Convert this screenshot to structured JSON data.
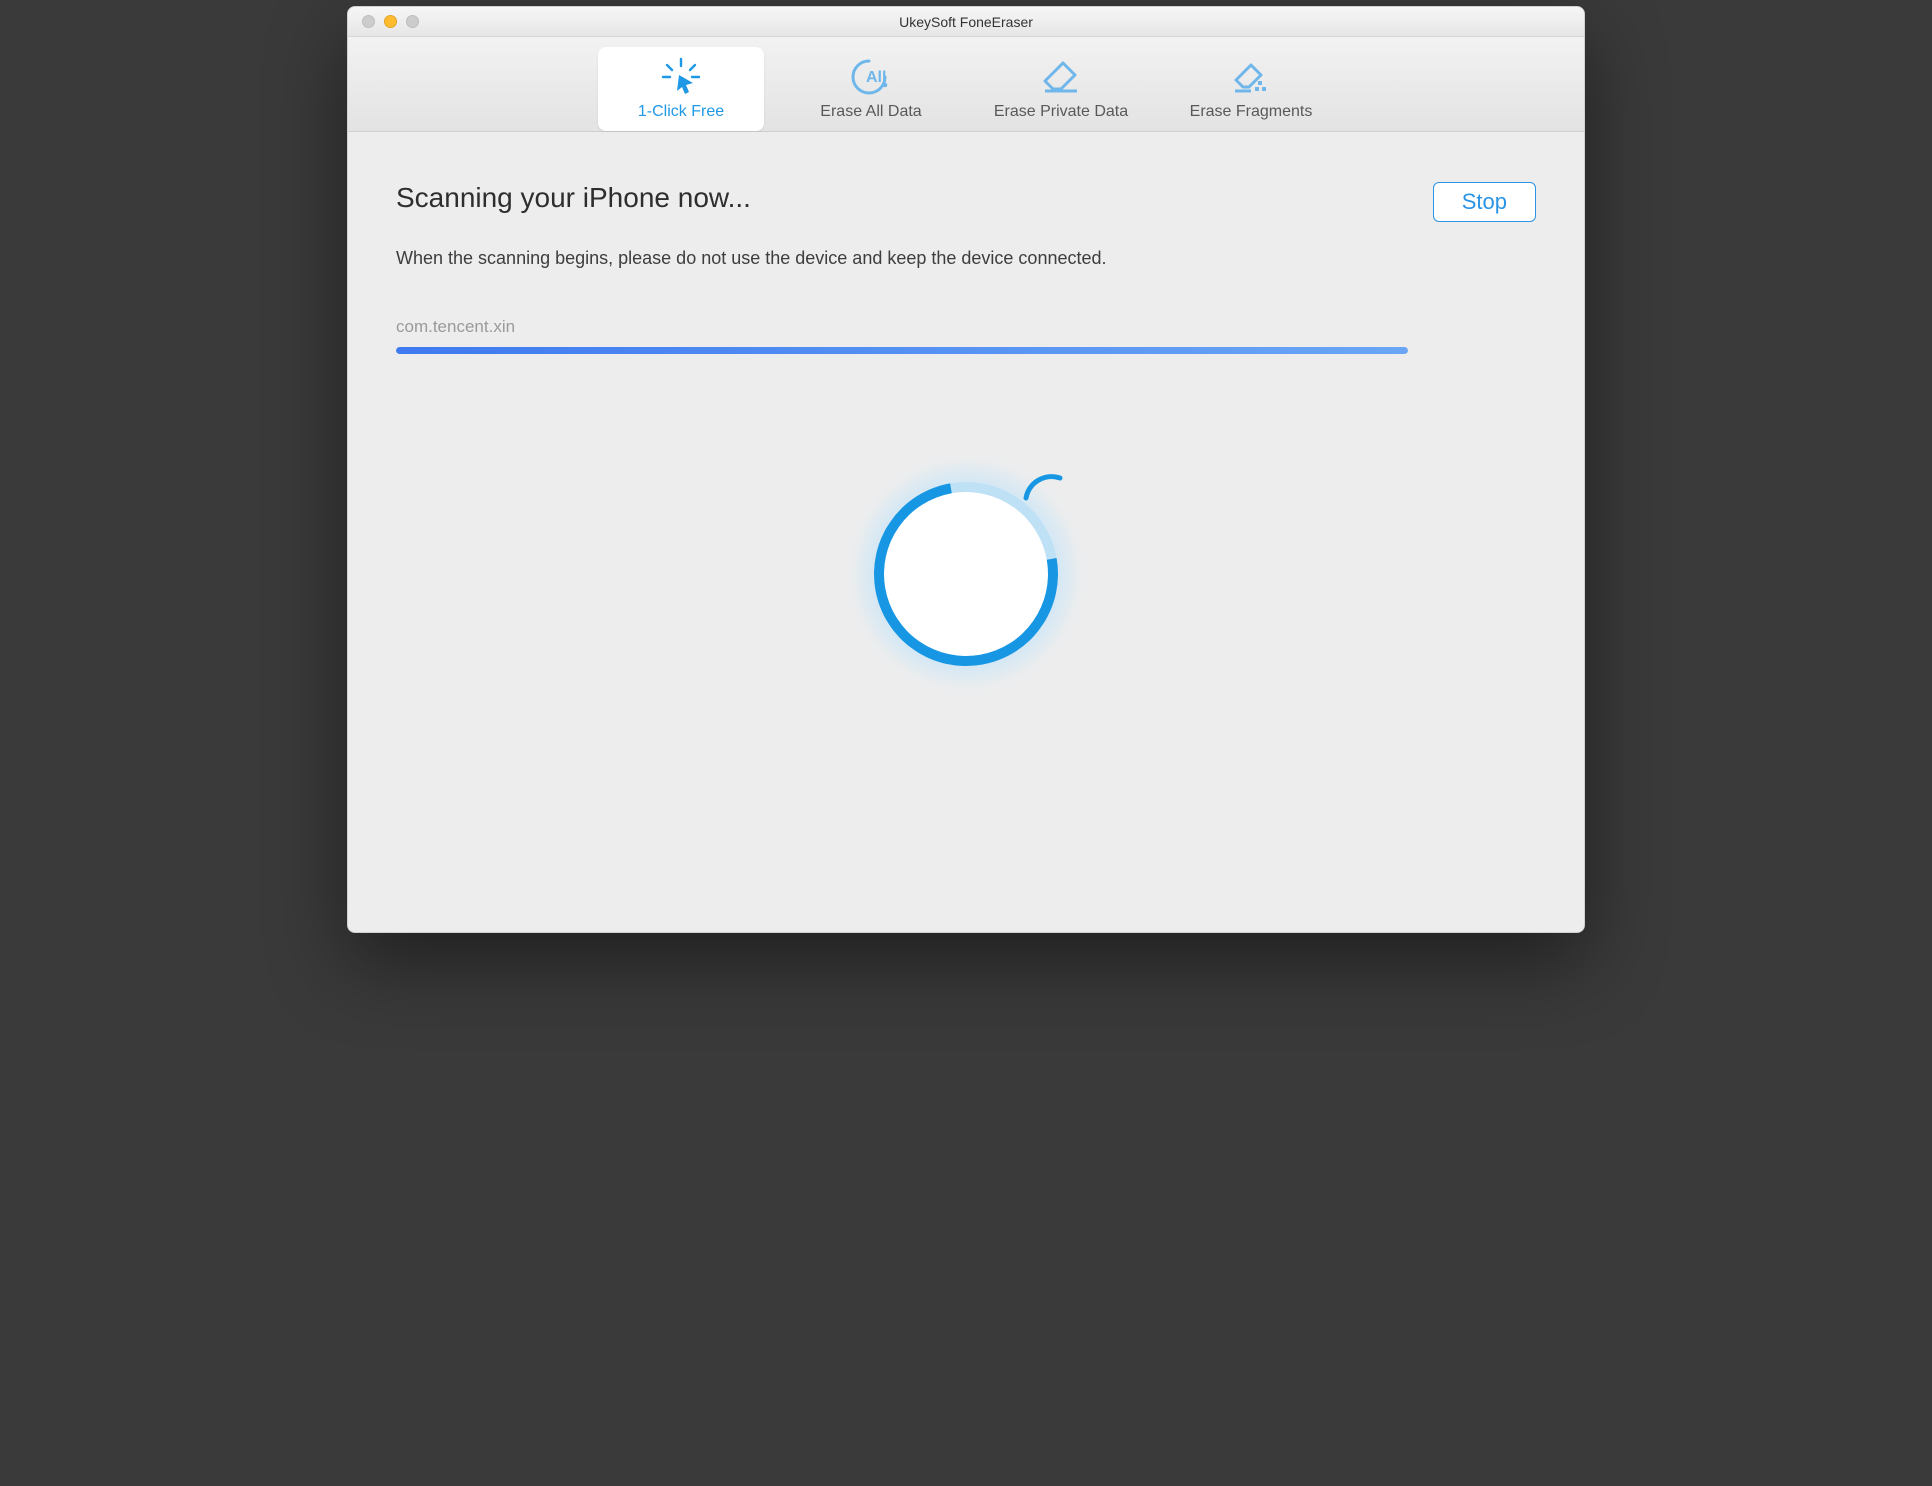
{
  "window": {
    "title": "UkeySoft FoneEraser"
  },
  "tabs": [
    {
      "label": "1-Click Free",
      "icon": "click-icon",
      "active": true
    },
    {
      "label": "Erase All Data",
      "icon": "all-icon",
      "active": false
    },
    {
      "label": "Erase Private Data",
      "icon": "eraser-icon",
      "active": false
    },
    {
      "label": "Erase Fragments",
      "icon": "eraser-fragment-icon",
      "active": false
    }
  ],
  "main": {
    "heading": "Scanning your iPhone now...",
    "subtext": "When the scanning begins, please do not use the device and keep the device connected.",
    "current_item": "com.tencent.xin",
    "progress_percent": 100,
    "stop_label": "Stop"
  },
  "colors": {
    "accent": "#1f98e6",
    "progress_start": "#3f7af0",
    "progress_end": "#6aa6f5"
  }
}
